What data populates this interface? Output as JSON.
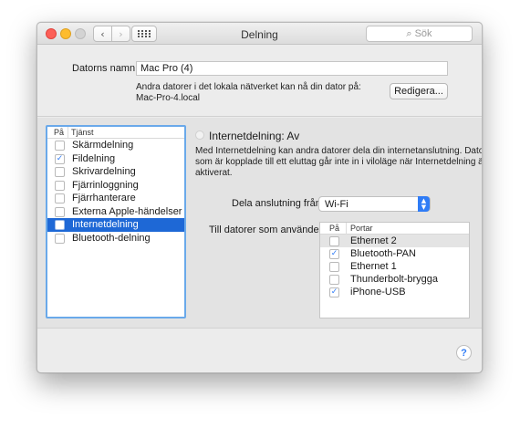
{
  "window": {
    "title": "Delning",
    "search_placeholder": "Sök",
    "nav": {
      "back_icon": "chevron-left-icon",
      "forward_icon": "chevron-right-icon",
      "grid_icon": "grid-icon"
    }
  },
  "computer": {
    "name_label": "Datorns namn:",
    "name_value": "Mac Pro (4)",
    "info_line1": "Andra datorer i det lokala nätverket kan nå din dator på:",
    "info_line2": "Mac-Pro-4.local",
    "edit_button": "Redigera..."
  },
  "services": {
    "header_on": "På",
    "header_service": "Tjänst",
    "items": [
      {
        "label": "Skärmdelning",
        "checked": false
      },
      {
        "label": "Fildelning",
        "checked": true
      },
      {
        "label": "Skrivardelning",
        "checked": false
      },
      {
        "label": "Fjärrinloggning",
        "checked": false
      },
      {
        "label": "Fjärrhanterare",
        "checked": false
      },
      {
        "label": "Externa Apple-händelser",
        "checked": false
      },
      {
        "label": "Internetdelning",
        "checked": false,
        "selected": true
      },
      {
        "label": "Bluetooth-delning",
        "checked": false
      }
    ]
  },
  "internet_sharing": {
    "status": "Internetdelning: Av",
    "description_line1": "Med Internetdelning kan andra datorer dela din internetanslutning. Datorer",
    "description_line2": "som är kopplade till ett eluttag går inte in i viloläge när Internetdelning är",
    "description_line3": "aktiverat.",
    "share_from_label": "Dela anslutning från:",
    "share_from_value": "Wi-Fi",
    "to_computers_label": "Till datorer som använder:",
    "ports_header_on": "På",
    "ports_header_ports": "Portar",
    "ports": [
      {
        "label": "Ethernet 2",
        "checked": false,
        "highlighted": true
      },
      {
        "label": "Bluetooth-PAN",
        "checked": true
      },
      {
        "label": "Ethernet 1",
        "checked": false
      },
      {
        "label": "Thunderbolt-brygga",
        "checked": false
      },
      {
        "label": "iPhone-USB",
        "checked": true
      }
    ]
  },
  "help_label": "?",
  "colors": {
    "accent": "#2f7cf6",
    "selection": "#1e68d6",
    "close": "#fc5f57",
    "minimize": "#fdbc2e"
  }
}
